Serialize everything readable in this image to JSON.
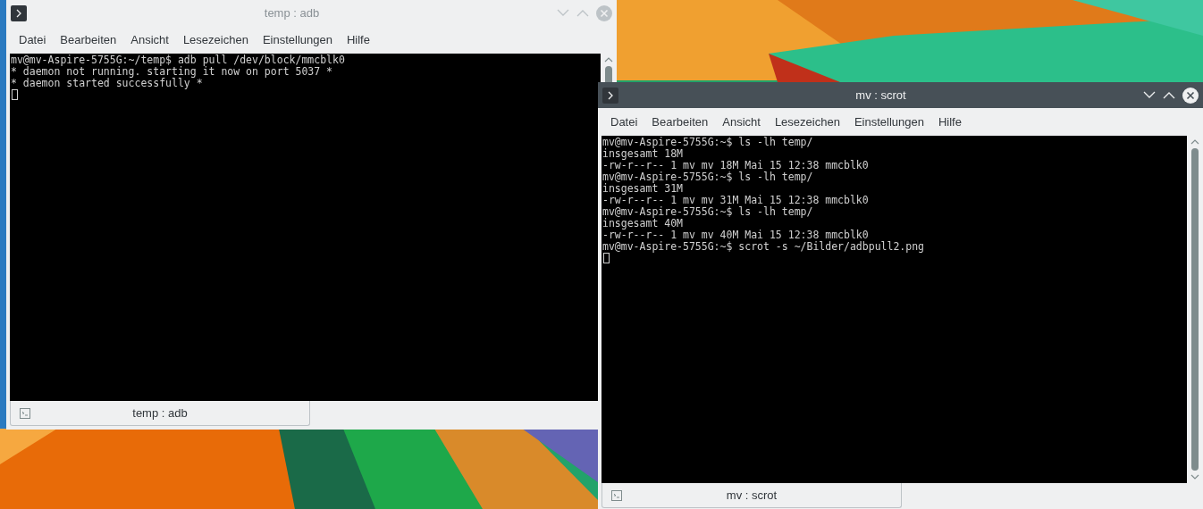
{
  "windows": [
    {
      "title": "temp : adb",
      "active": false,
      "menu": [
        "Datei",
        "Bearbeiten",
        "Ansicht",
        "Lesezeichen",
        "Einstellungen",
        "Hilfe"
      ],
      "lines": [
        "mv@mv-Aspire-5755G:~/temp$ adb pull /dev/block/mmcblk0",
        "* daemon not running. starting it now on port 5037 *",
        "* daemon started successfully *"
      ],
      "tab": "temp : adb"
    },
    {
      "title": "mv : scrot",
      "active": true,
      "menu": [
        "Datei",
        "Bearbeiten",
        "Ansicht",
        "Lesezeichen",
        "Einstellungen",
        "Hilfe"
      ],
      "lines": [
        "mv@mv-Aspire-5755G:~$ ls -lh temp/",
        "insgesamt 18M",
        "-rw-r--r-- 1 mv mv 18M Mai 15 12:38 mmcblk0",
        "mv@mv-Aspire-5755G:~$ ls -lh temp/",
        "insgesamt 31M",
        "-rw-r--r-- 1 mv mv 31M Mai 15 12:38 mmcblk0",
        "mv@mv-Aspire-5755G:~$ ls -lh temp/",
        "insgesamt 40M",
        "-rw-r--r-- 1 mv mv 40M Mai 15 12:38 mmcblk0",
        "mv@mv-Aspire-5755G:~$ scrot -s ~/Bilder/adbpull2.png"
      ],
      "tab": "mv : scrot"
    }
  ]
}
